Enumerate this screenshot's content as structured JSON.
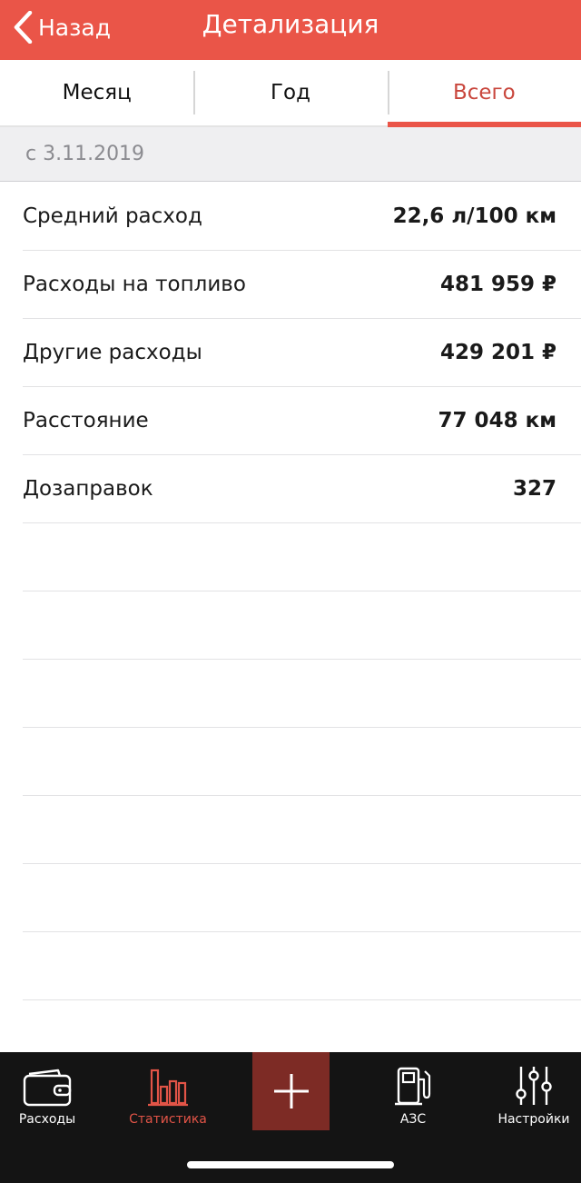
{
  "header": {
    "back_label": "Назад",
    "title": "Детализация",
    "background": "#ea5548"
  },
  "tabs": [
    {
      "label": "Месяц",
      "active": false
    },
    {
      "label": "Год",
      "active": false
    },
    {
      "label": "Всего",
      "active": true
    }
  ],
  "period": {
    "label": "с 3.11.2019"
  },
  "stats": [
    {
      "label": "Средний расход",
      "value": "22,6 л/100 км"
    },
    {
      "label": "Расходы на топливо",
      "value": "481 959 ₽"
    },
    {
      "label": "Другие расходы",
      "value": "429 201 ₽"
    },
    {
      "label": "Расстояние",
      "value": "77 048 км"
    },
    {
      "label": "Дозаправок",
      "value": "327"
    }
  ],
  "tabbar": {
    "items": [
      {
        "label": "Расходы",
        "icon": "wallet-icon",
        "active": false
      },
      {
        "label": "Статистика",
        "icon": "bar-chart-icon",
        "active": true
      },
      {
        "label": "",
        "icon": "plus-icon",
        "active": false
      },
      {
        "label": "АЗС",
        "icon": "fuel-pump-icon",
        "active": false
      },
      {
        "label": "Настройки",
        "icon": "sliders-icon",
        "active": false
      }
    ]
  },
  "colors": {
    "accent": "#ea5548",
    "active_tab_text": "#c9473d",
    "tabbar_bg": "#141414",
    "add_button_bg": "#7d2b25"
  }
}
